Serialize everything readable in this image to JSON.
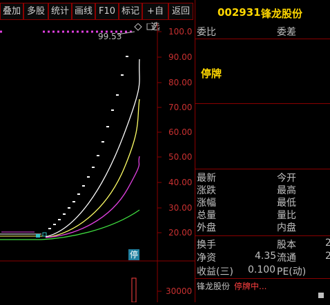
{
  "toolbar": {
    "buttons": [
      "叠加",
      "多股",
      "统计",
      "画线",
      "F10",
      "标记",
      "+自选",
      "返回"
    ]
  },
  "stock": {
    "code": "002931",
    "name": "锋龙股份"
  },
  "chart": {
    "price_label": "99.53",
    "y_ticks": [
      "100.0",
      "90.00",
      "80.00",
      "70.00",
      "60.00",
      "50.00",
      "40.00",
      "30.00",
      "20.00"
    ],
    "volume_tick": "30000",
    "halt_badge": "停"
  },
  "panel": {
    "weibi_label": "委比",
    "weicha_label": "委差",
    "status": "停牌",
    "rows_left": [
      "最新",
      "涨跌",
      "涨幅",
      "总量",
      "外盘"
    ],
    "rows_right": [
      "今开",
      "最高",
      "最低",
      "量比",
      "内盘"
    ],
    "huanshou_label": "换手",
    "guben_label": "股本",
    "guben_value": "2",
    "jingzi_label": "净资",
    "jingzi_value": "4.35",
    "liutong_label": "流通",
    "liutong_value": "2",
    "shouyi_label": "收益(三)",
    "shouyi_value": "0.100",
    "pe_label": "PE(动)",
    "ticker_name": "锋龙股份",
    "ticker_status": "停牌中..."
  },
  "colors": {
    "accent_red": "#c83030",
    "title_yellow": "#ffd700",
    "white_line": "#ffffff",
    "yellow_line": "#ffff66",
    "magenta_line": "#e040e0",
    "green_line": "#40e040"
  }
}
